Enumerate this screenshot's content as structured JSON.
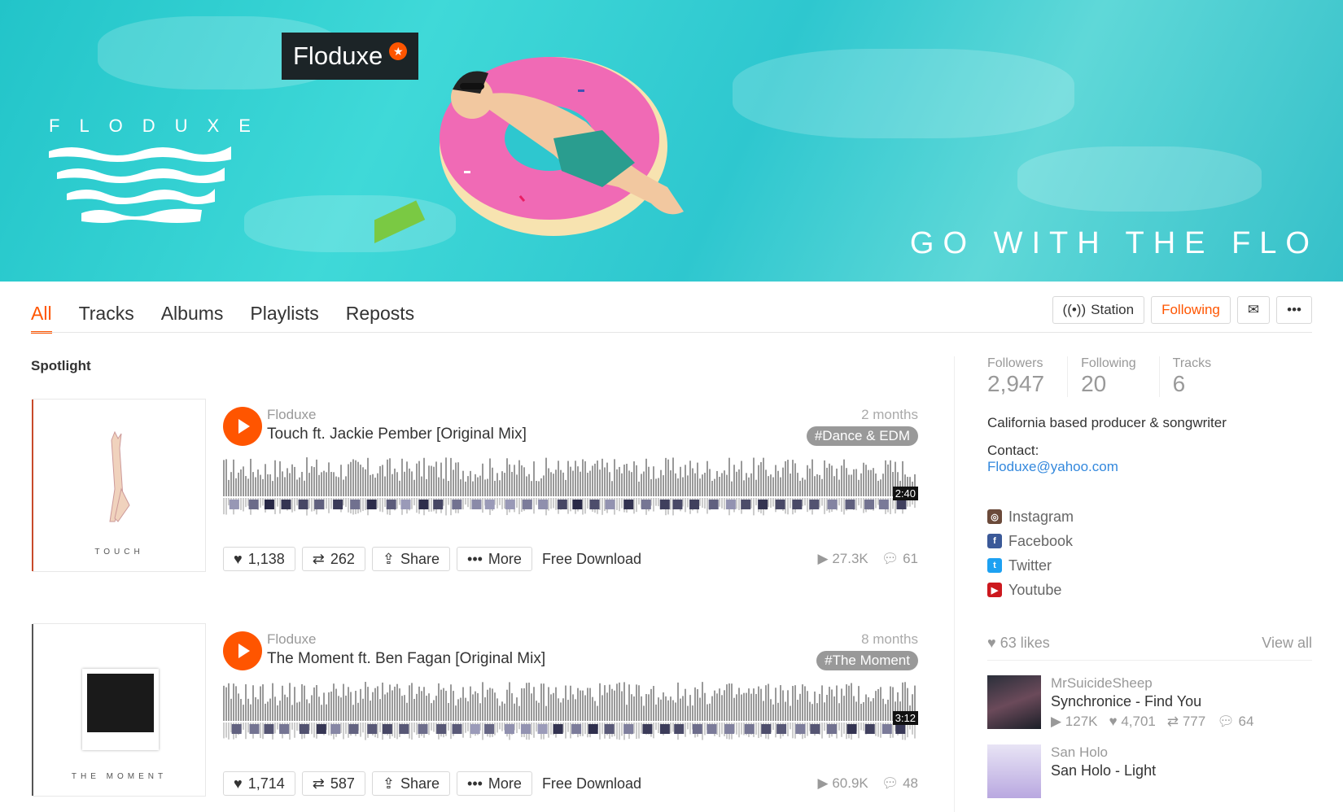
{
  "banner": {
    "artist_name": "Floduxe",
    "logo_text": "FLODUXE",
    "slogan": "GO WITH THE FLO"
  },
  "tabs": [
    "All",
    "Tracks",
    "Albums",
    "Playlists",
    "Reposts"
  ],
  "actions": {
    "station": "Station",
    "following": "Following"
  },
  "section_title": "Spotlight",
  "tracks": [
    {
      "artist": "Floduxe",
      "title": "Touch ft. Jackie Pember [Original Mix]",
      "date": "2 months",
      "tag": "Dance & EDM",
      "duration": "2:40",
      "likes": "1,138",
      "reposts": "262",
      "share": "Share",
      "more": "More",
      "free_download": "Free Download",
      "plays": "27.3K",
      "comments": "61",
      "art_caption": "TOUCH"
    },
    {
      "artist": "Floduxe",
      "title": "The Moment ft. Ben Fagan [Original Mix]",
      "date": "8 months",
      "tag": "The Moment",
      "duration": "3:12",
      "likes": "1,714",
      "reposts": "587",
      "share": "Share",
      "more": "More",
      "free_download": "Free Download",
      "plays": "60.9K",
      "comments": "48",
      "art_caption": "THE MOMENT"
    }
  ],
  "sidebar": {
    "stats": [
      {
        "label": "Followers",
        "value": "2,947"
      },
      {
        "label": "Following",
        "value": "20"
      },
      {
        "label": "Tracks",
        "value": "6"
      }
    ],
    "bio": "California based producer & songwriter",
    "contact_label": "Contact:",
    "contact_email": "Floduxe@yahoo.com",
    "social": [
      {
        "name": "Instagram",
        "color": "#6b4a3a"
      },
      {
        "name": "Facebook",
        "color": "#3b5998"
      },
      {
        "name": "Twitter",
        "color": "#1da1f2"
      },
      {
        "name": "Youtube",
        "color": "#cc181e"
      }
    ],
    "likes_count": "63 likes",
    "view_all": "View all",
    "liked_tracks": [
      {
        "artist": "MrSuicideSheep",
        "title": "Synchronice - Find You",
        "plays": "127K",
        "likes": "4,701",
        "reposts": "777",
        "comments": "64"
      },
      {
        "artist": "San Holo",
        "title": "San Holo - Light"
      }
    ]
  }
}
